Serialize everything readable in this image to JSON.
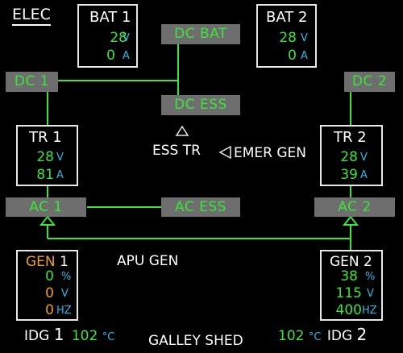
{
  "page_title": "ELEC",
  "colors": {
    "green": "#3ce43c",
    "cyan": "#2fb6e6",
    "amber": "#f0a020",
    "bus_gray": "#6e6e6e"
  },
  "bat1": {
    "title": "BAT 1",
    "volts": "28",
    "volts_unit": "V",
    "amps": "0",
    "amps_unit": "A"
  },
  "bat2": {
    "title": "BAT 2",
    "volts": "28",
    "volts_unit": "V",
    "amps": "0",
    "amps_unit": "A"
  },
  "buses": {
    "dc_bat": "DC BAT",
    "dc1": "DC 1",
    "dc2": "DC 2",
    "dc_ess": "DC ESS",
    "ac1": "AC 1",
    "ac2": "AC 2",
    "ac_ess": "AC ESS"
  },
  "tr1": {
    "title": "TR 1",
    "volts": "28",
    "volts_unit": "V",
    "amps": "81",
    "amps_unit": "A"
  },
  "tr2": {
    "title": "TR 2",
    "volts": "28",
    "volts_unit": "V",
    "amps": "39",
    "amps_unit": "A"
  },
  "ess_tr_label": "ESS TR",
  "emer_gen_label": "EMER GEN",
  "apu_gen_label": "APU GEN",
  "gen1": {
    "title_prefix": "GEN",
    "title_num": "1",
    "load": "0",
    "load_unit": "%",
    "volts": "0",
    "volts_unit": "V",
    "freq": "0",
    "freq_unit": "HZ"
  },
  "gen2": {
    "title_prefix": "GEN",
    "title_num": "2",
    "load": "38",
    "load_unit": "%",
    "volts": "115",
    "volts_unit": "V",
    "freq": "400",
    "freq_unit": "HZ"
  },
  "idg1": {
    "label": "IDG",
    "num": "1",
    "temp": "102",
    "temp_unit": "°C"
  },
  "idg2": {
    "label": "IDG",
    "num": "2",
    "temp": "102",
    "temp_unit": "°C"
  },
  "galley_shed_label": "GALLEY SHED"
}
